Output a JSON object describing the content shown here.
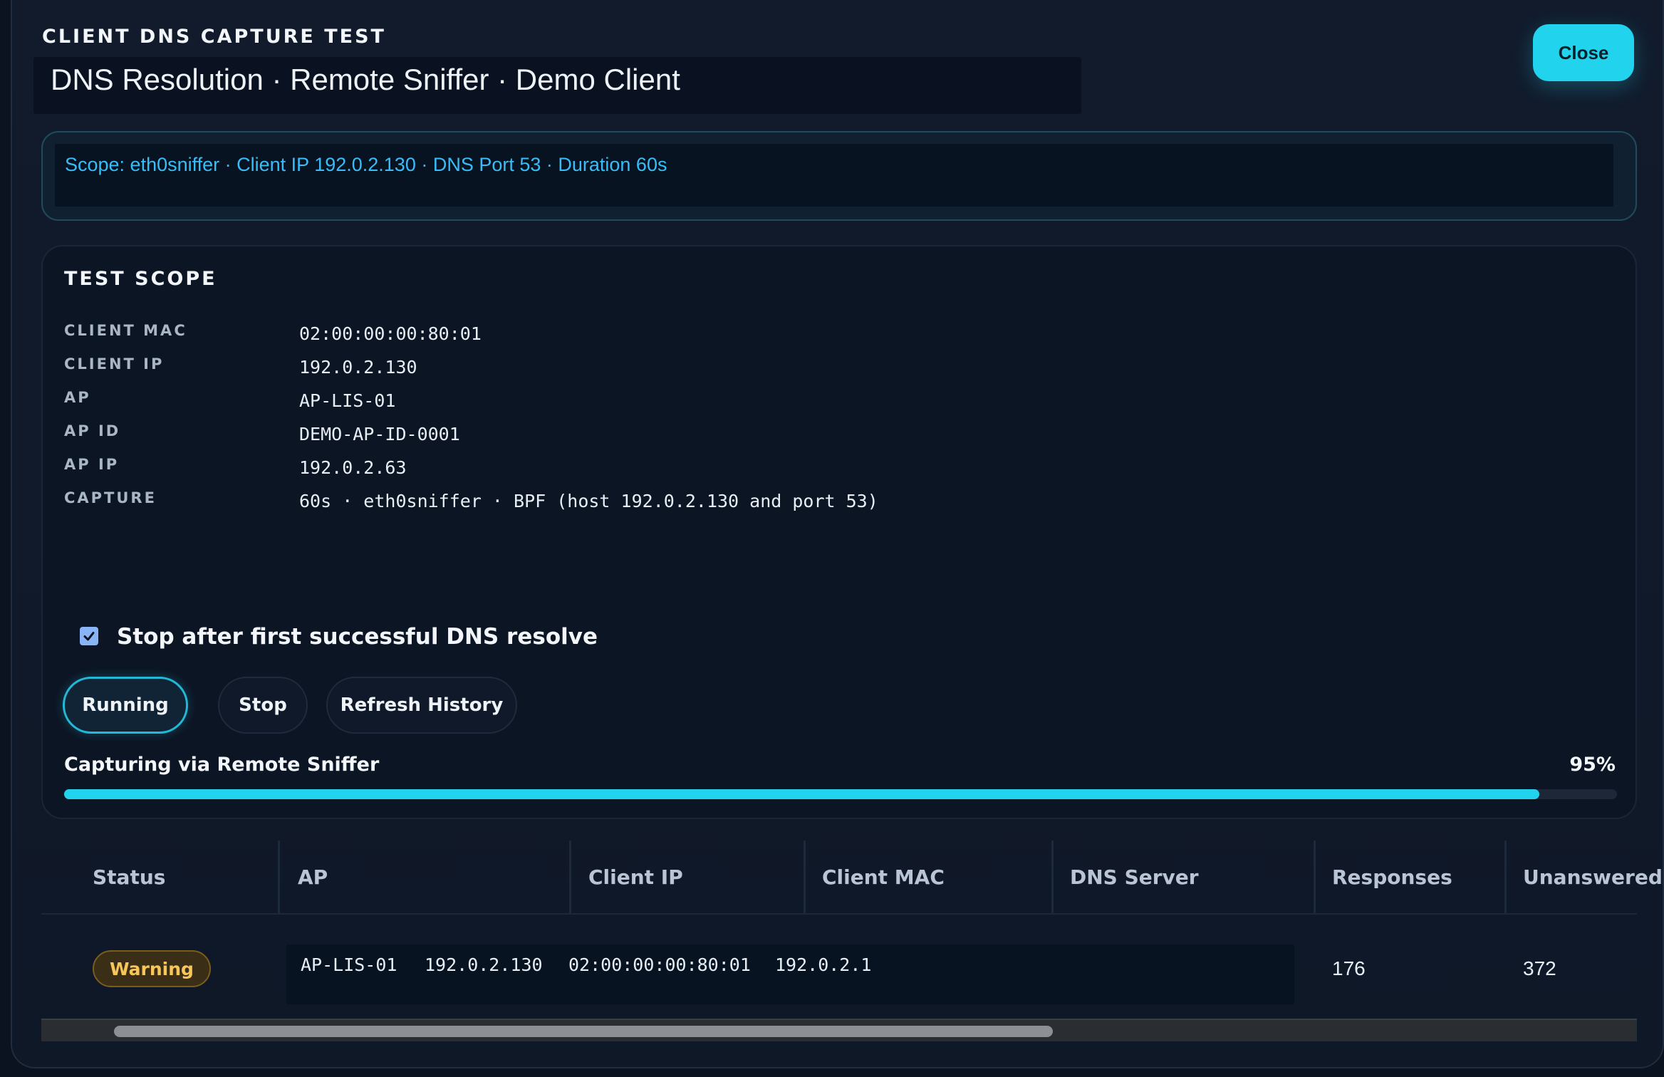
{
  "header": {
    "eyebrow": "CLIENT DNS CAPTURE TEST",
    "title": "DNS Resolution · Remote Sniffer · Demo Client",
    "close_label": "Close"
  },
  "scope_summary": "Scope: eth0sniffer · Client IP 192.0.2.130 · DNS Port 53 · Duration 60s",
  "test_scope": {
    "title": "TEST SCOPE",
    "fields": [
      {
        "label": "CLIENT MAC",
        "value": "02:00:00:00:80:01"
      },
      {
        "label": "CLIENT IP",
        "value": "192.0.2.130"
      },
      {
        "label": "AP",
        "value": "AP-LIS-01"
      },
      {
        "label": "AP ID",
        "value": "DEMO-AP-ID-0001"
      },
      {
        "label": "AP IP",
        "value": "192.0.2.63"
      },
      {
        "label": "CAPTURE",
        "value": "60s · eth0sniffer · BPF (host 192.0.2.130 and port 53)"
      }
    ],
    "stop_after_first": {
      "label": "Stop after first successful DNS resolve",
      "checked": true
    },
    "buttons": {
      "running": "Running",
      "stop": "Stop",
      "refresh": "Refresh History"
    },
    "progress": {
      "label": "Capturing via Remote Sniffer",
      "percent_label": "95%",
      "value": 0.95
    }
  },
  "table": {
    "columns": [
      "Status",
      "AP",
      "Client IP",
      "Client MAC",
      "DNS Server",
      "Responses",
      "Unanswered"
    ],
    "rows": [
      {
        "status": "Warning",
        "ap": "AP-LIS-01",
        "client_ip": "192.0.2.130",
        "client_mac": "02:00:00:00:80:01",
        "dns_server": "192.0.2.1",
        "responses": "176",
        "unanswered": "372"
      }
    ]
  },
  "colors": {
    "accent": "#22d3ee",
    "warning": "#f7c65b",
    "background": "#0b1220"
  }
}
